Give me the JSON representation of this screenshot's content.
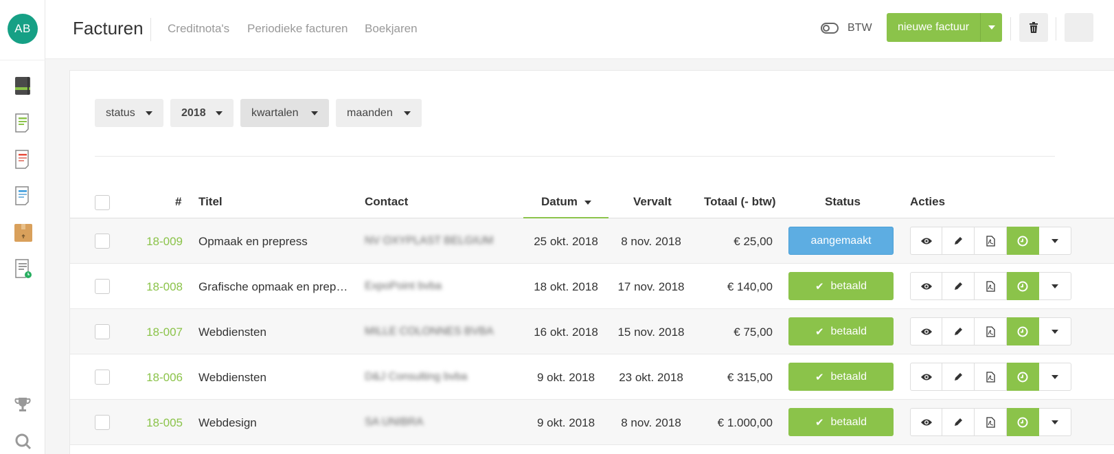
{
  "user": {
    "initials": "AB"
  },
  "header": {
    "title": "Facturen",
    "nav": [
      "Creditnota's",
      "Periodieke facturen",
      "Boekjaren"
    ],
    "btw_label": "BTW",
    "new_button": "nieuwe factuur"
  },
  "colors": {
    "accent": "#8bc34a",
    "status_blue": "#5dade2",
    "avatar": "#16a085"
  },
  "sidebar": {
    "icons": [
      "ledger-icon",
      "invoice-icon",
      "credit-note-icon",
      "quote-icon",
      "box-icon",
      "recurring-invoice-icon",
      "trophy-icon",
      "search-icon"
    ]
  },
  "filters": {
    "status": "status",
    "year": "2018",
    "quarters": "kwartalen",
    "months": "maanden"
  },
  "table": {
    "columns": {
      "num": "#",
      "titel": "Titel",
      "contact": "Contact",
      "datum": "Datum",
      "vervalt": "Vervalt",
      "totaal": "Totaal (- btw)",
      "status": "Status",
      "acties": "Acties"
    },
    "rows": [
      {
        "num": "18-009",
        "titel": "Opmaak en prepress",
        "contact": "NV OXYPLAST BELGIUM",
        "datum": "25 okt. 2018",
        "vervalt": "8 nov. 2018",
        "totaal": "€ 25,00",
        "status": "aangemaakt"
      },
      {
        "num": "18-008",
        "titel": "Grafische opmaak en prep…",
        "contact": "ExpoPoint bvba",
        "datum": "18 okt. 2018",
        "vervalt": "17 nov. 2018",
        "totaal": "€ 140,00",
        "status": "betaald"
      },
      {
        "num": "18-007",
        "titel": "Webdiensten",
        "contact": "MILLE COLONNES BVBA",
        "datum": "16 okt. 2018",
        "vervalt": "15 nov. 2018",
        "totaal": "€ 75,00",
        "status": "betaald"
      },
      {
        "num": "18-006",
        "titel": "Webdiensten",
        "contact": "D&J Consulting bvba",
        "datum": "9 okt. 2018",
        "vervalt": "23 okt. 2018",
        "totaal": "€ 315,00",
        "status": "betaald"
      },
      {
        "num": "18-005",
        "titel": "Webdesign",
        "contact": "SA UNIBRA",
        "datum": "9 okt. 2018",
        "vervalt": "8 nov. 2018",
        "totaal": "€ 1.000,00",
        "status": "betaald"
      }
    ]
  }
}
